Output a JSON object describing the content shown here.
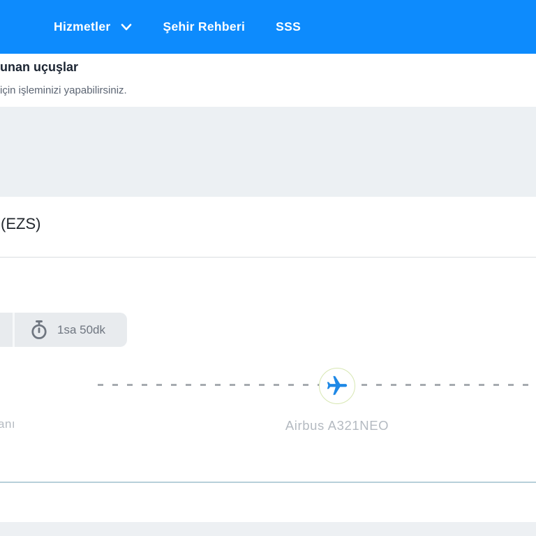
{
  "colors": {
    "header_bg": "#0d8bfd",
    "band_bg": "#ecf0f3",
    "badge_bg": "#e8ebee",
    "divider": "#d9dde0",
    "teal_line": "#b7cfd9",
    "plane_blue": "#1e88e6",
    "circle_border": "#d7e7b2",
    "muted_text": "#b4bac1",
    "dark_text": "#1b2432",
    "subtitle_text": "#5c6573",
    "badge_text": "#6f7680",
    "dash_gray": "#a6abb0"
  },
  "header": {
    "nav": [
      {
        "label": "Hizmetler",
        "has_dropdown": true
      },
      {
        "label": "Şehir Rehberi",
        "has_dropdown": false
      },
      {
        "label": "SSS",
        "has_dropdown": false
      }
    ]
  },
  "results": {
    "title": "unan uçuşlar",
    "subtitle": "için işleminizi yapabilirsiniz."
  },
  "flight": {
    "airport_code": "(EZS)",
    "duration": "1sa 50dk",
    "origin_label": "anı",
    "aircraft": "Airbus A321NEO"
  }
}
